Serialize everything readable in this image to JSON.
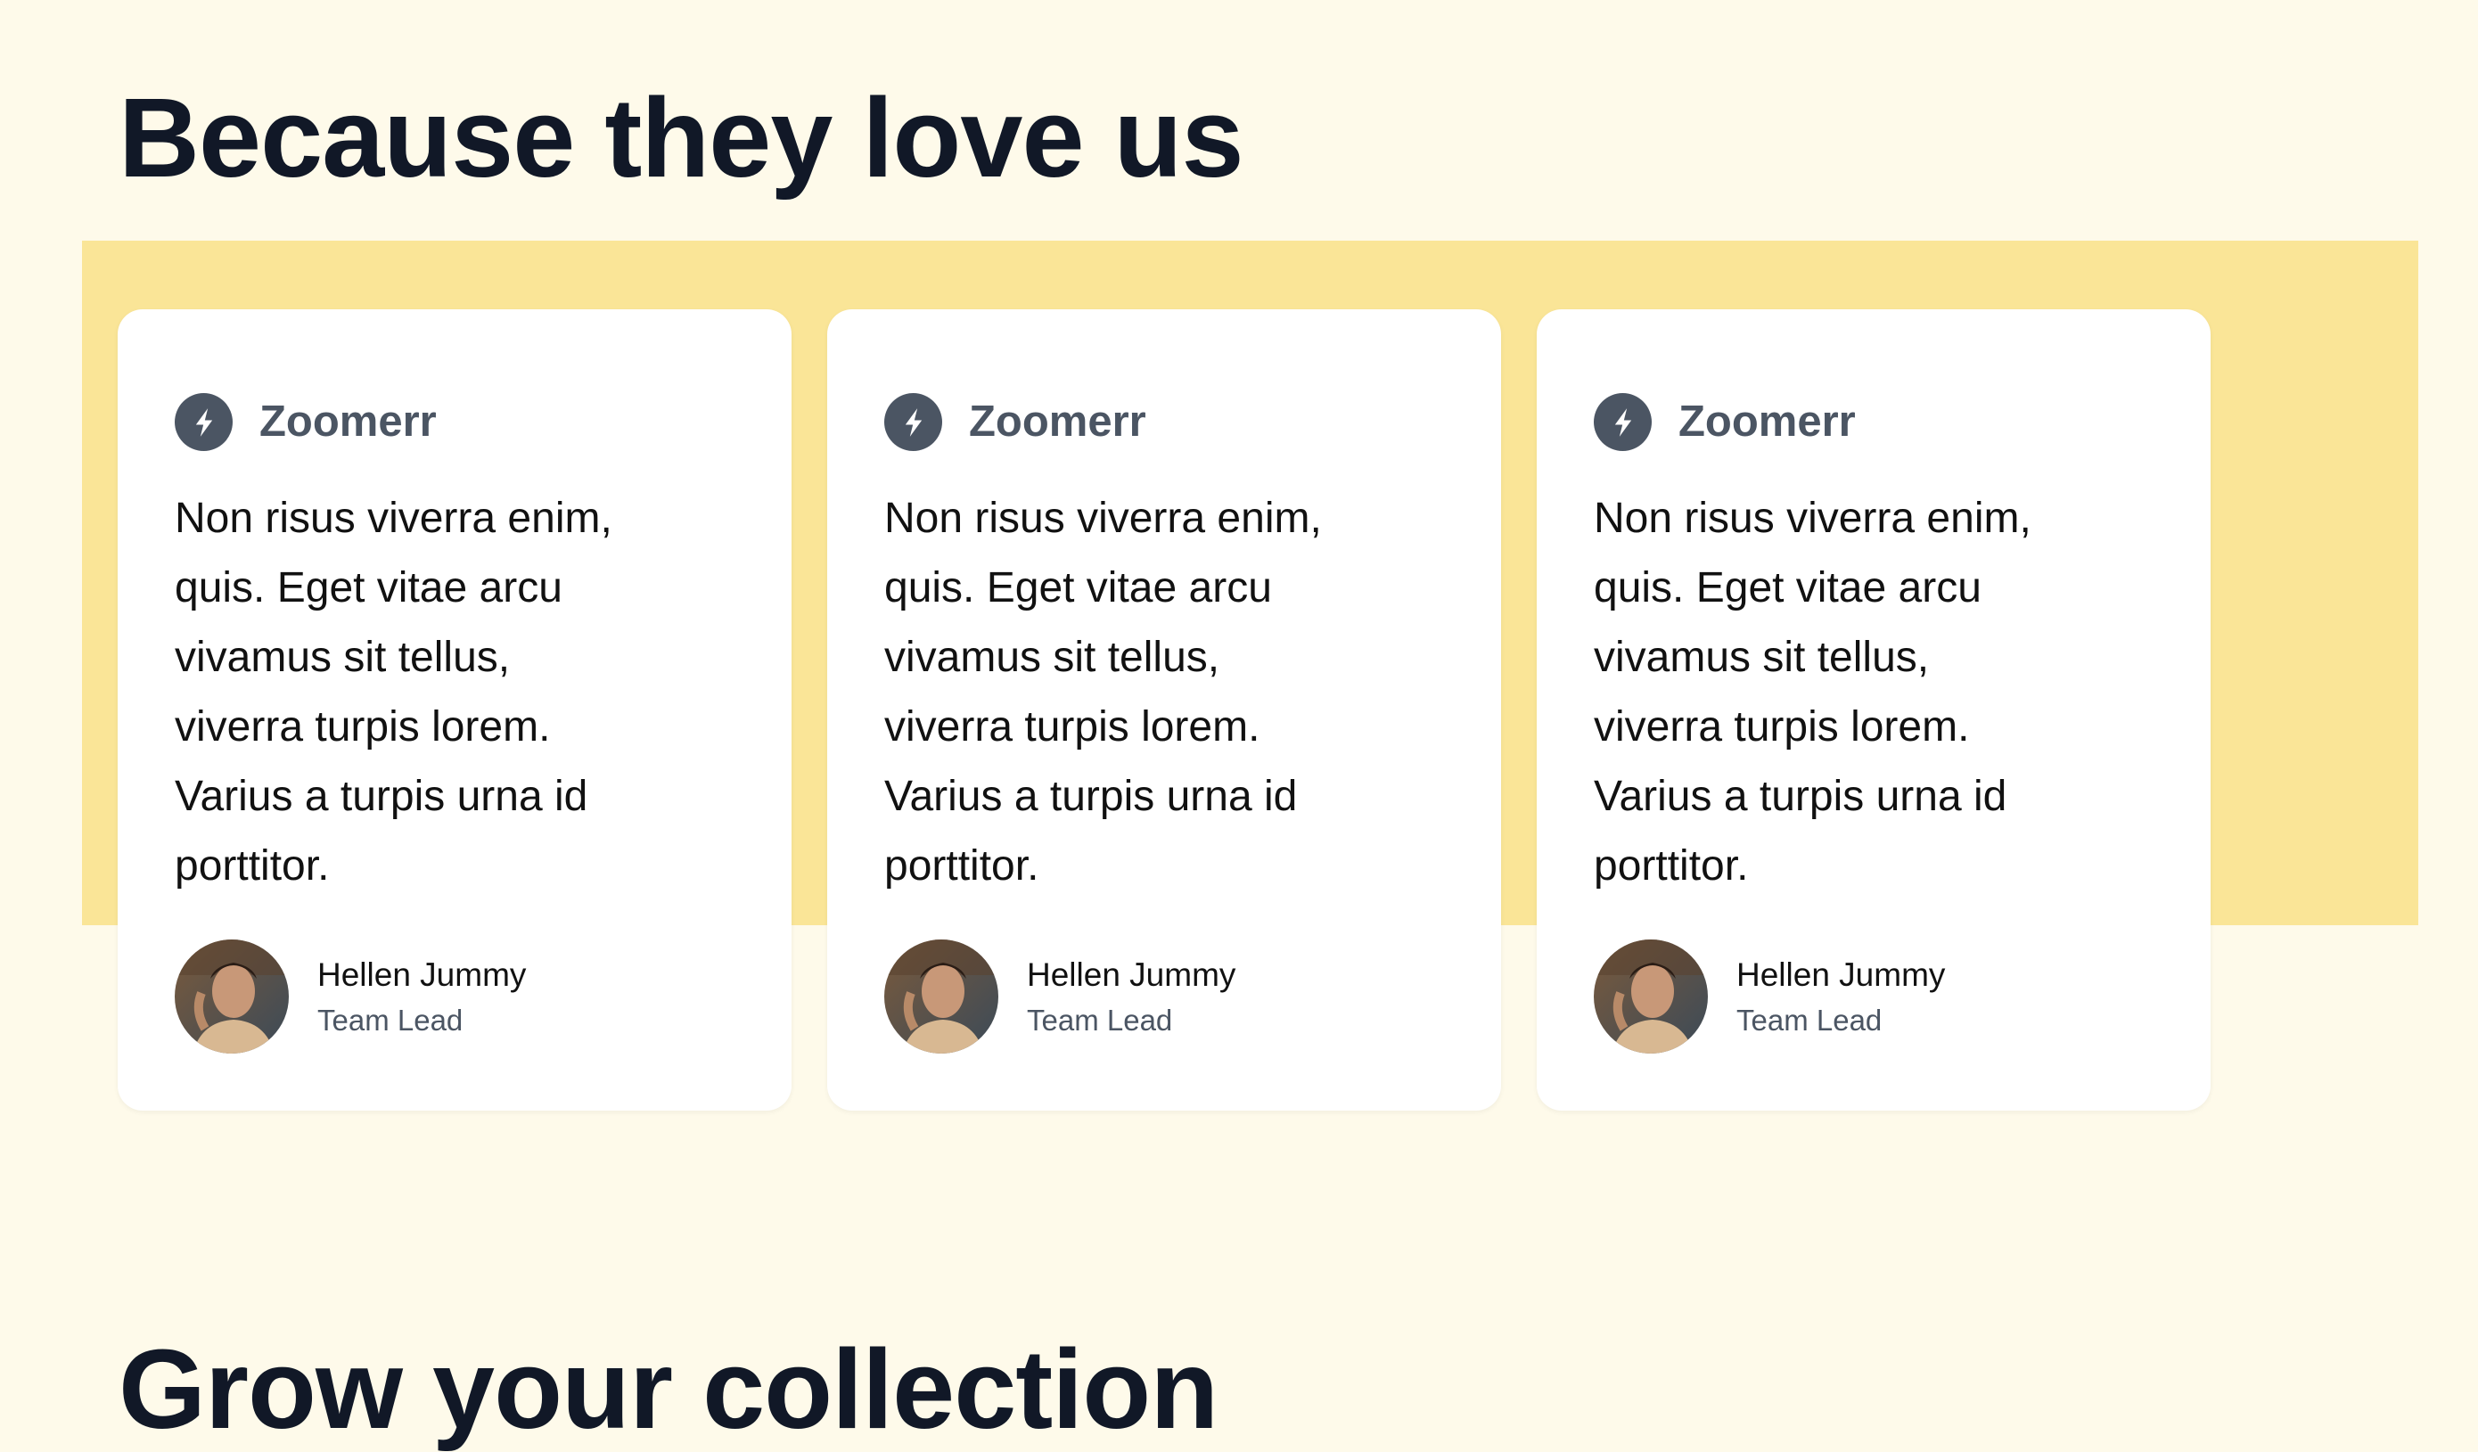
{
  "testimonials_section": {
    "title": "Because they love us",
    "cards": [
      {
        "brand": "Zoomerr",
        "brand_icon": "lightning-bolt-icon",
        "quote": "Non risus viverra enim, quis. Eget vitae arcu vivamus sit tellus, viverra turpis lorem. Varius a turpis urna id porttitor.",
        "author_name": "Hellen Jummy",
        "author_role": "Team Lead"
      },
      {
        "brand": "Zoomerr",
        "brand_icon": "lightning-bolt-icon",
        "quote": "Non risus viverra enim, quis. Eget vitae arcu vivamus sit tellus, viverra turpis lorem. Varius a turpis urna id porttitor.",
        "author_name": "Hellen Jummy",
        "author_role": "Team Lead"
      },
      {
        "brand": "Zoomerr",
        "brand_icon": "lightning-bolt-icon",
        "quote": "Non risus viverra enim, quis. Eget vitae arcu vivamus sit tellus, viverra turpis lorem. Varius a turpis urna id porttitor.",
        "author_name": "Hellen Jummy",
        "author_role": "Team Lead"
      }
    ]
  },
  "collection_section": {
    "title": "Grow your collection"
  },
  "colors": {
    "page_background": "#fefaea",
    "band_background": "#fae597",
    "card_background": "#ffffff",
    "heading_text": "#111827",
    "brand_gray": "#4b5563"
  }
}
